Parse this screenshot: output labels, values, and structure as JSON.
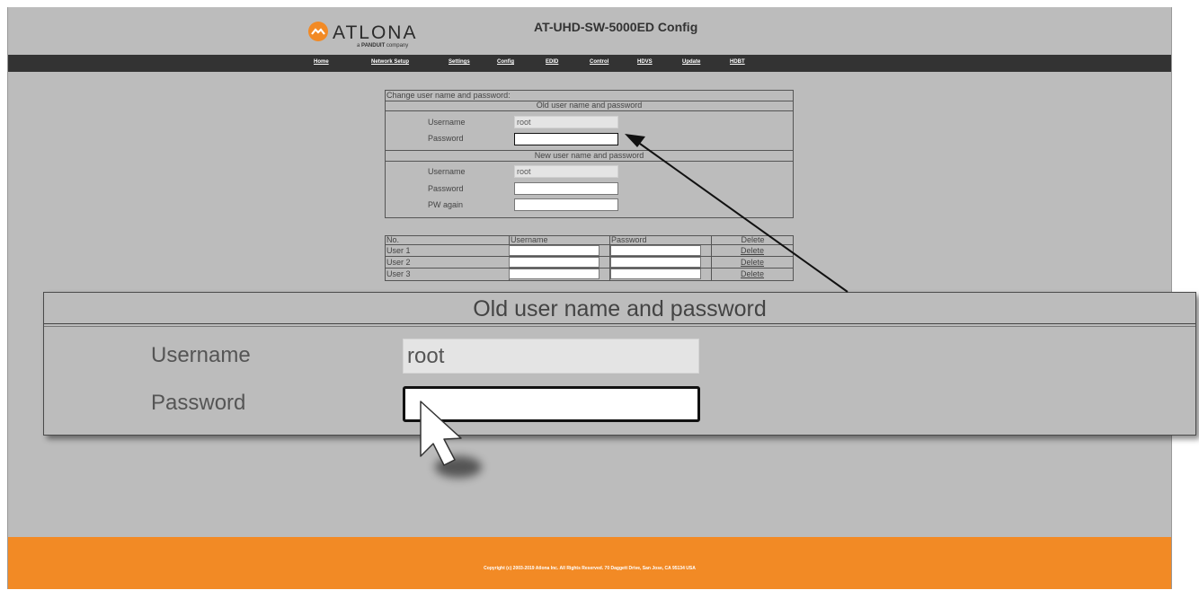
{
  "header": {
    "logo_text": "ATLONA",
    "logo_tagline_prefix": "a",
    "logo_tagline_brand": "PANDUIT",
    "logo_tagline_suffix": "company",
    "title": "AT-UHD-SW-5000ED Config"
  },
  "nav": {
    "items": [
      "Home",
      "Network Setup",
      "Settings",
      "Config",
      "EDID",
      "Control",
      "HDVS",
      "Update",
      "HDBT"
    ]
  },
  "credentials": {
    "section_label": "Change user name and password:",
    "old_title": "Old user name and password",
    "new_title": "New user name and password",
    "username_label": "Username",
    "password_label": "Password",
    "pw_again_label": "PW again",
    "old_username_value": "root",
    "new_username_value": "root"
  },
  "users_table": {
    "headers": [
      "No.",
      "Username",
      "Password",
      "Delete"
    ],
    "rows": [
      {
        "no": "User 1",
        "delete": "Delete"
      },
      {
        "no": "User 2",
        "delete": "Delete"
      },
      {
        "no": "User 3",
        "delete": "Delete"
      }
    ]
  },
  "zoom_callout": {
    "title": "Old user name and password",
    "username_label": "Username",
    "password_label": "Password",
    "username_value": "root"
  },
  "footer": {
    "copyright": "Copyright (c) 2003-2019 Atlona Inc. All Rights Reserved. 70 Daggett Drive, San Jose, CA 95134 USA"
  },
  "colors": {
    "page_bg": "#bcbcbc",
    "nav_bg": "#333333",
    "footer_bg": "#f28a25",
    "logo_orange": "#f28a25"
  },
  "icons": [
    "atlona-logo-icon",
    "mouse-pointer-icon",
    "callout-arrow-icon"
  ]
}
